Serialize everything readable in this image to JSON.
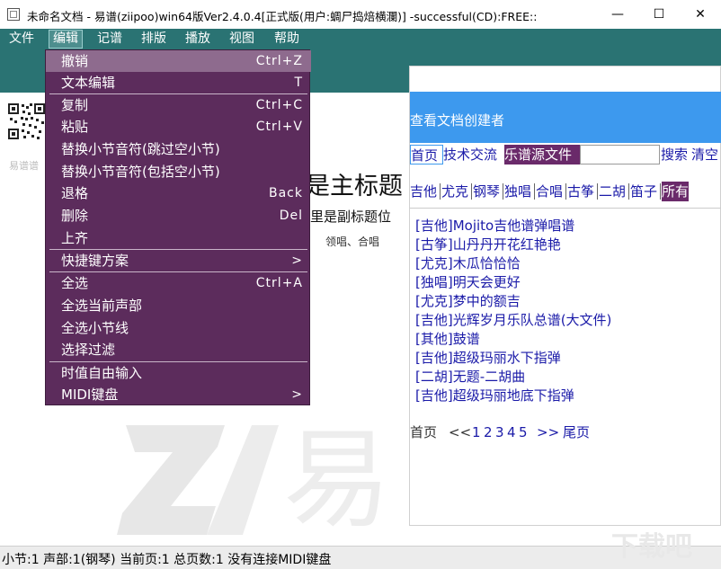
{
  "window": {
    "title": "未命名文档 - 易谱(ziipoo)win64版Ver2.4.0.4[正式版(用户:蜩尸捣焙横瀾)] -successful(CD):FREE::",
    "minimize": "—",
    "maximize": "☐",
    "close": "✕"
  },
  "menubar": {
    "items": [
      {
        "label": "文件"
      },
      {
        "label": "编辑"
      },
      {
        "label": "记谱"
      },
      {
        "label": "排版"
      },
      {
        "label": "播放"
      },
      {
        "label": "视图"
      },
      {
        "label": "帮助"
      }
    ]
  },
  "edit_menu": {
    "items": [
      {
        "label": "撤销",
        "shortcut": "Ctrl+Z"
      },
      {
        "label": "文本编辑",
        "shortcut": "T"
      },
      {
        "label": "复制",
        "shortcut": "Ctrl+C"
      },
      {
        "label": "粘贴",
        "shortcut": "Ctrl+V"
      },
      {
        "label": "替换小节音符(跳过空小节)",
        "shortcut": ""
      },
      {
        "label": "替换小节音符(包括空小节)",
        "shortcut": ""
      },
      {
        "label": "退格",
        "shortcut": "Back"
      },
      {
        "label": "删除",
        "shortcut": "Del"
      },
      {
        "label": "上齐",
        "shortcut": ""
      },
      {
        "label": "快捷键方案",
        "shortcut": ">"
      },
      {
        "label": "全选",
        "shortcut": "Ctrl+A"
      },
      {
        "label": "全选当前声部",
        "shortcut": ""
      },
      {
        "label": "全选小节线",
        "shortcut": ""
      },
      {
        "label": "选择过滤",
        "shortcut": ""
      },
      {
        "label": "时值自由输入",
        "shortcut": ""
      },
      {
        "label": "MIDI键盘",
        "shortcut": ">"
      }
    ]
  },
  "document": {
    "qr_label": "易谱谱",
    "main_title": "是主标题",
    "subtitle": "里是副标题位",
    "credits": "领唱、合唱"
  },
  "panel": {
    "header": "查看文档创建者",
    "nav": [
      "首页",
      "技术交流",
      "乐谱源文件",
      "搜索",
      "清空"
    ],
    "categories": [
      "吉他",
      "尤克",
      "钢琴",
      "独唱",
      "合唱",
      "古筝",
      "二胡",
      "笛子",
      "所有"
    ],
    "songs": [
      "[吉他]Mojito吉他谱弹唱谱",
      "[古筝]山丹丹开花红艳艳",
      "[尤克]木瓜恰恰恰",
      "[独唱]明天会更好",
      "[尤克]梦中的额吉",
      "[吉他]光辉岁月乐队总谱(大文件)",
      "[其他]鼓谱",
      "[吉他]超级玛丽水下指弹",
      "[二胡]无题-二胡曲",
      "[吉他]超级玛丽地底下指弹"
    ],
    "pager": {
      "first": "首页",
      "prev": "<<",
      "pages": [
        "1",
        "2",
        "3",
        "4",
        "5"
      ],
      "next": ">>",
      "last": "尾页"
    }
  },
  "status": {
    "text": "小节:1 声部:1(钢琴) 当前页:1 总页数:1 没有连接MIDI键盘"
  },
  "corner_logo": "下载吧"
}
